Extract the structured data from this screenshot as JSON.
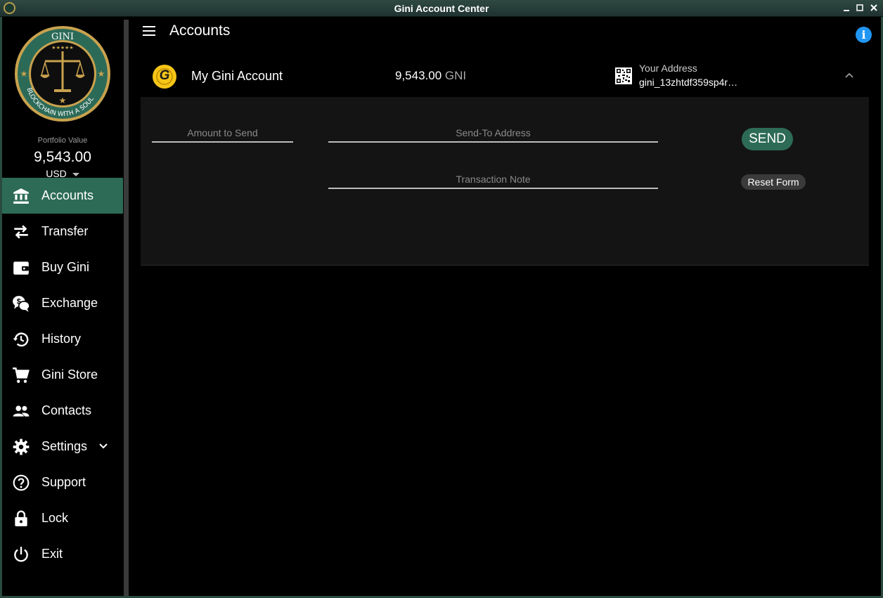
{
  "window": {
    "title": "Gini Account Center"
  },
  "sidebar": {
    "logo": {
      "top_text": "GINI",
      "ring_text": "BLOCKCHAIN WITH A SOUL"
    },
    "portfolio": {
      "label": "Portfolio Value",
      "value": "9,543.00",
      "currency": "USD"
    },
    "items": [
      {
        "label": "Accounts",
        "icon": "bank-icon",
        "active": true
      },
      {
        "label": "Transfer",
        "icon": "swap-arrows-icon"
      },
      {
        "label": "Buy Gini",
        "icon": "wallet-icon"
      },
      {
        "label": "Exchange",
        "icon": "chat-dollar-icon"
      },
      {
        "label": "History",
        "icon": "history-icon"
      },
      {
        "label": "Gini Store",
        "icon": "cart-icon"
      },
      {
        "label": "Contacts",
        "icon": "people-icon"
      },
      {
        "label": "Settings",
        "icon": "gear-icon"
      },
      {
        "label": "Support",
        "icon": "help-circle-icon"
      },
      {
        "label": "Lock",
        "icon": "lock-icon"
      },
      {
        "label": "Exit",
        "icon": "power-icon"
      }
    ]
  },
  "header": {
    "title": "Accounts"
  },
  "account": {
    "coin_letter": "G",
    "name": "My Gini Account",
    "balance": "9,543.00",
    "unit": "GNI",
    "address_label": "Your Address",
    "address": "gini_13zhtdf359sp4r…"
  },
  "form": {
    "amount_placeholder": "Amount to Send",
    "address_placeholder": "Send-To Address",
    "note_placeholder": "Transaction Note",
    "send_label": "SEND",
    "reset_label": "Reset Form"
  },
  "colors": {
    "accent": "#2d6b57",
    "info": "#2196f3",
    "coin": "#f5c518"
  }
}
